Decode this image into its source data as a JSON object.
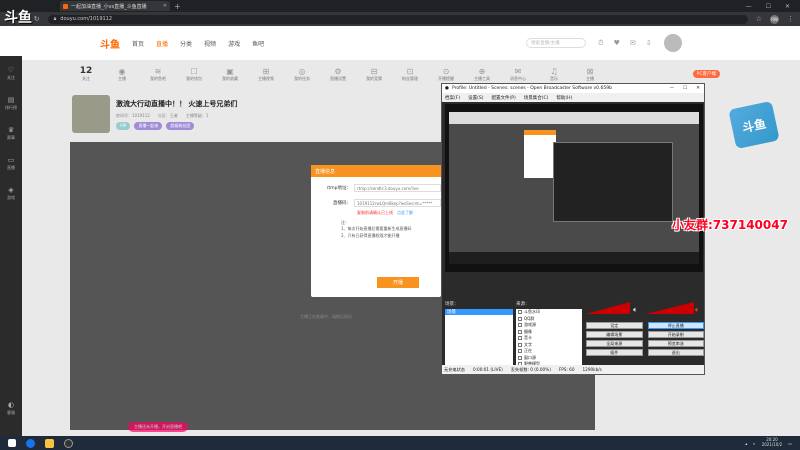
{
  "watermark": "斗鱼",
  "browser": {
    "tab_title": "一起加油直播_小vs直播_斗鱼直播",
    "url": "douyu.com/1019112",
    "profile": "RW"
  },
  "douyu": {
    "logo": "斗鱼",
    "nav": [
      "首页",
      "直播",
      "分类",
      "视频",
      "游戏",
      "鱼吧"
    ],
    "search_placeholder": "搜索直播/主播",
    "left": [
      "关注",
      "排行榜",
      "赛事",
      "直播",
      "游戏"
    ],
    "left_bottom": "客服",
    "categories": [
      {
        "icon": "12",
        "label": "关注"
      },
      {
        "icon": "◉",
        "label": "主播"
      },
      {
        "icon": "≋",
        "label": "我的鱼吧"
      },
      {
        "icon": "☐",
        "label": "我的钱包"
      },
      {
        "icon": "▣",
        "label": "我的收藏"
      },
      {
        "icon": "⊞",
        "label": "主播视频"
      },
      {
        "icon": "◎",
        "label": "我的任务"
      },
      {
        "icon": "⚙",
        "label": "直播设置"
      },
      {
        "icon": "⊟",
        "label": "我的竞猜"
      },
      {
        "icon": "⊡",
        "label": "粉丝管理"
      },
      {
        "icon": "⊙",
        "label": "开播提醒"
      },
      {
        "icon": "⊕",
        "label": "主播工具"
      },
      {
        "icon": "✉",
        "label": "消息中心"
      },
      {
        "icon": "♫",
        "label": "音乐"
      },
      {
        "icon": "⊠",
        "label": "主播"
      }
    ],
    "pc_button": "PC客户端",
    "room_title": "激流大行动直播中！！ 火速上号兄弟们",
    "room_meta": [
      "房间号：1019112",
      "分区：王者",
      "主播等级：1"
    ],
    "room_badges": [
      "VIP",
      "直播一起来",
      "超级粉丝团"
    ],
    "player_hint": "主播正在准备中，请稍后再试",
    "pill": "主播还未开播，开启直播吧",
    "ad_text": "斗鱼"
  },
  "modal": {
    "title": "直播信息",
    "rtmp_label": "rtmp地址：",
    "rtmp_value": "rtmp://sendtc3.douyu.com/live",
    "code_label": "直播码：",
    "code_value": "1019112rwLQm8kep?wsSecret=*****",
    "warn": "复制前请确认已上线",
    "warn_link": "点此了解",
    "note1": "注：",
    "note2": "1、每次开始直播后需要重新生成直播码",
    "note3": "2、只有已获得直播权限才能开播",
    "button": "开播"
  },
  "obs": {
    "title": "Profile: Untitled - Scenes: scenes - Open Broadcaster Software v0.659b",
    "menu": [
      "档案(F)",
      "设置(S)",
      "配置文件(P)",
      "场景集合(C)",
      "帮助(H)"
    ],
    "overlay_text": "小友群:737140047",
    "scenes_label": "场景：",
    "scenes": [
      "场景"
    ],
    "sources_label": "来源：",
    "sources": [
      "斗鱼水印",
      "QQ群",
      "游戏源",
      "摄像",
      "音卡",
      "文字",
      "正在",
      "窗口源",
      "野兽模型"
    ],
    "buttons": [
      "设定",
      "停止直播",
      "编辑场景",
      "开始录制",
      "全局来源",
      "预览串流",
      "插件",
      "退出"
    ],
    "status": [
      "无充电状态",
      "0:00:01 (LIVE)",
      "丢失帧数: 0 (0.00%)",
      "FPS: 60",
      "1290kb/s"
    ]
  },
  "taskbar": {
    "time": "20:20",
    "date": "2021/10/2"
  }
}
